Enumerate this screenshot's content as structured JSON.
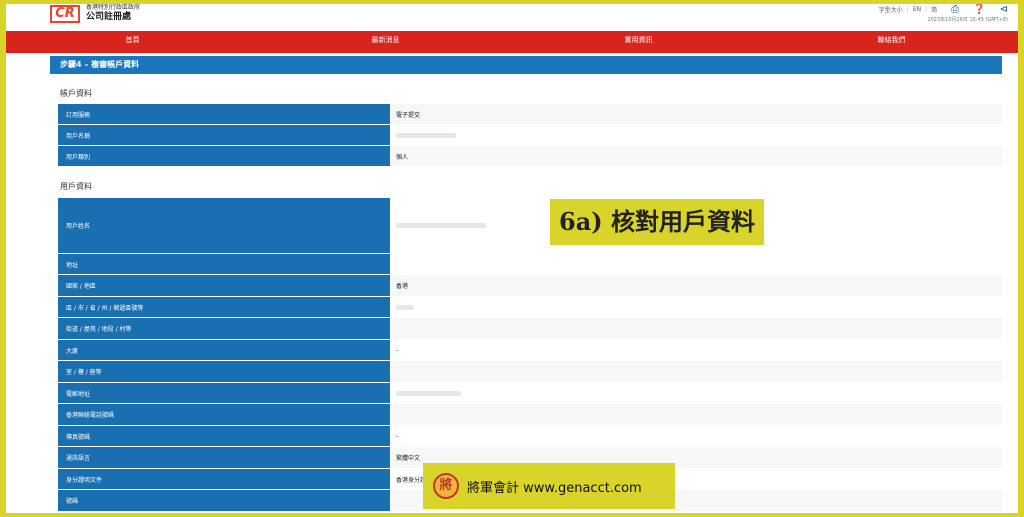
{
  "header": {
    "logo_text": "CR",
    "org_subtitle": "香港特別行政區政府",
    "org_name": "公司註冊處",
    "top_links": [
      "字型大小",
      "EN",
      "简"
    ],
    "timestamp": "2023年10月26日 15:45 (GMT+8)"
  },
  "nav": {
    "items": [
      "首頁",
      "最新消息",
      "實用資訊",
      "聯絡我們"
    ]
  },
  "step": {
    "title": "步驟4 – 複審帳戶資料"
  },
  "account_section": {
    "title": "帳戶資料",
    "rows": [
      {
        "label": "訂用服務",
        "value": "電子提交"
      },
      {
        "label": "用戶名稱",
        "value": ""
      },
      {
        "label": "用戶類別",
        "value": "個人"
      }
    ]
  },
  "user_section": {
    "title": "用戶資料",
    "rows": [
      {
        "label": "用戶姓名",
        "value": ""
      },
      {
        "label": "地址",
        "value": ""
      },
      {
        "label": "國家 / 地區",
        "value": "香港"
      },
      {
        "label": "區 / 市 / 省 / 州 / 郵遞區號等",
        "value": ""
      },
      {
        "label": "街道 / 屋苑 / 地段 / 村等",
        "value": ""
      },
      {
        "label": "大廈",
        "value": "-"
      },
      {
        "label": "室 / 樓 / 座等",
        "value": ""
      },
      {
        "label": "電郵地址",
        "value": ""
      },
      {
        "label": "香港聯絡電話號碼",
        "value": ""
      },
      {
        "label": "傳真號碼",
        "value": "-"
      },
      {
        "label": "通訊語言",
        "value": "繁體中文"
      },
      {
        "label": "身分證明文件",
        "value": "香港身分證"
      },
      {
        "label": "號碼",
        "value": ""
      }
    ]
  },
  "overlay": {
    "step_label": "6a) 核對用戶資料",
    "footer_seal": "將",
    "footer_text": "將軍會計 www.genacct.com"
  },
  "colors": {
    "frame": "#d8d42a",
    "nav_red": "#d9231d",
    "label_blue": "#1a6fb0",
    "step_blue": "#1b75bb"
  }
}
